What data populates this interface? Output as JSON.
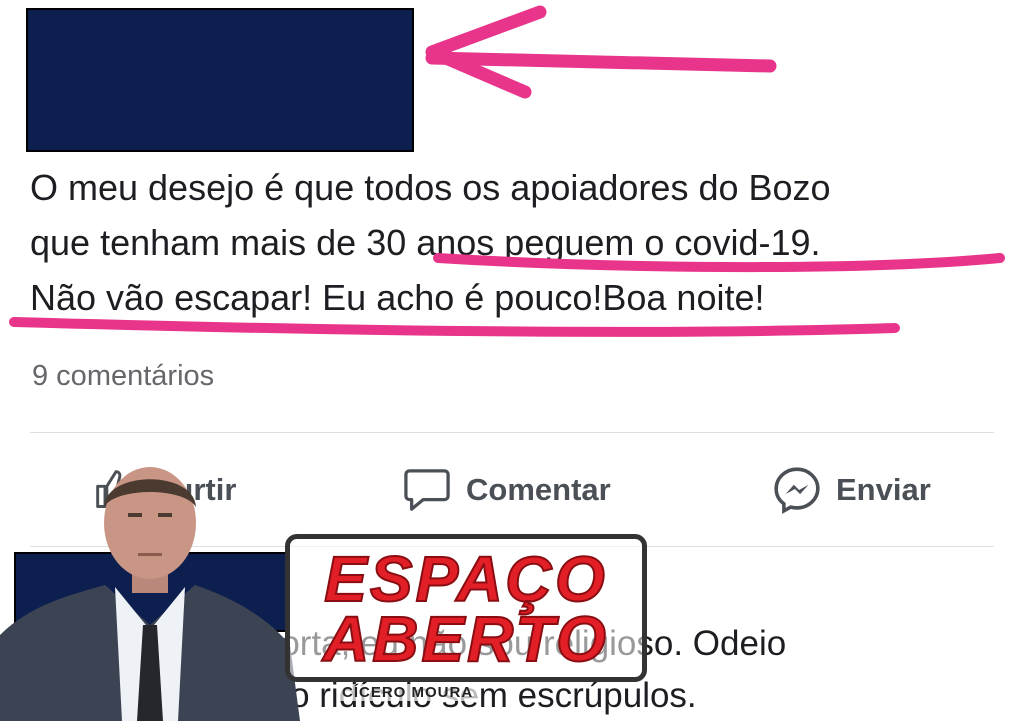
{
  "post": {
    "text_lines": [
      "O meu desejo é que todos os apoiadores do Bozo",
      "que tenham mais de 30 anos peguem o covid-19.",
      "Não vão escapar!  Eu acho é pouco!Boa noite!"
    ],
    "comments_count": "9 comentários"
  },
  "actions": {
    "like_label": "Curtir",
    "comment_label": "Comentar",
    "send_label": "Enviar"
  },
  "comment": {
    "text_lines": [
      "Não importa, eu não sou religioso. Odeio",
      "esse povo ridículo sem escrúpulos."
    ]
  },
  "watermark": {
    "line1": "ESPAÇO",
    "line2": "ABERTO",
    "credit": "CÍCERO MOURA"
  },
  "colors": {
    "redaction": "#0c1f4f",
    "annotation": "#e8348a",
    "logo_red": "#e21f26",
    "secondary_text": "#65676b"
  },
  "icons": {
    "like": "thumbs-up-icon",
    "comment": "speech-bubble-icon",
    "send": "messenger-icon"
  }
}
